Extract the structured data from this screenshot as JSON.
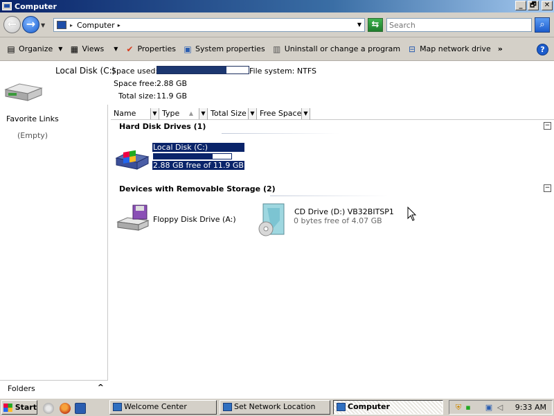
{
  "window": {
    "title": "Computer",
    "controls": [
      "_",
      "🗗",
      "✕"
    ]
  },
  "address_bar": {
    "location": "Computer",
    "search_placeholder": "Search"
  },
  "toolbar": {
    "items": [
      {
        "label": "Organize",
        "icon": "organize-icon",
        "has_dropdown": true
      },
      {
        "label": "Views",
        "icon": "views-icon",
        "has_dropdown": true
      },
      {
        "label": "Properties",
        "icon": "checkmark-icon"
      },
      {
        "label": "System properties",
        "icon": "system-properties-icon"
      },
      {
        "label": "Uninstall or change a program",
        "icon": "uninstall-icon"
      },
      {
        "label": "Map network drive",
        "icon": "network-drive-icon"
      }
    ],
    "overflow": "»",
    "help": "?"
  },
  "details": {
    "name": "Local Disk (C:)",
    "space_used_label": "Space used:",
    "space_used_fraction": 0.76,
    "space_free_label": "Space free:",
    "space_free_value": "2.88 GB",
    "total_size_label": "Total size:",
    "total_size_value": "11.9 GB",
    "filesystem": "File system: NTFS"
  },
  "navigation": {
    "favorite_links_title": "Favorite Links",
    "favorite_links_empty": "(Empty)",
    "folders_label": "Folders",
    "folders_caret": "^"
  },
  "columns": [
    "Name",
    "Type",
    "Total Size",
    "Free Space"
  ],
  "groups": [
    {
      "title": "Hard Disk Drives (1)",
      "items": [
        {
          "name": "Local Disk (C:)",
          "info": "2.88 GB free of 11.9 GB",
          "used_fraction": 0.76,
          "selected": true,
          "icon": "hard-drive-icon"
        }
      ]
    },
    {
      "title": "Devices with Removable Storage (2)",
      "items": [
        {
          "name": "Floppy Disk Drive (A:)",
          "icon": "floppy-drive-icon"
        },
        {
          "name": "CD Drive (D:) VB32BITSP1",
          "info": "0 bytes free of 4.07 GB",
          "icon": "cd-drive-icon"
        }
      ]
    }
  ],
  "taskbar": {
    "start_label": "Start",
    "tasks": [
      "Welcome Center",
      "Set Network Location",
      "Computer"
    ],
    "active_task": "Computer",
    "clock": "9:33 AM"
  }
}
